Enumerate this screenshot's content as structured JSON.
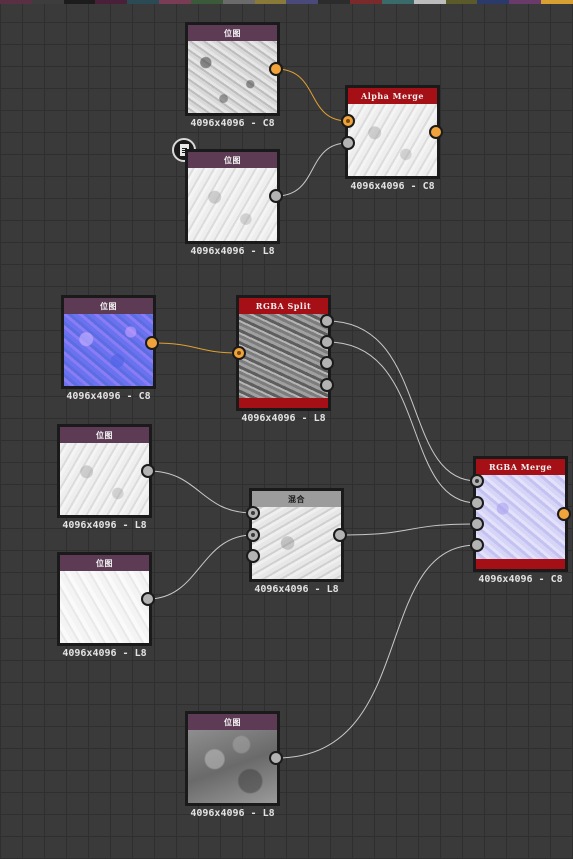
{
  "palette_swatches": [
    "#5a2f44",
    "#3d3d3d",
    "#1c1c1c",
    "#4a1f3a",
    "#2a4a55",
    "#7a3b55",
    "#3a5a3a",
    "#6b6b6b",
    "#8a7a3a",
    "#4a4a7a",
    "#2c2c2c",
    "#7a2a2a",
    "#3a6a6a",
    "#bdbdbd",
    "#5a5a2a",
    "#2a3a6a",
    "#6a3a6a",
    "#d8a030"
  ],
  "colors": {
    "header_purple": "#5e3b55",
    "header_red": "#a50f16",
    "header_gray": "#9c9c9c",
    "port_orange": "#f0a33a",
    "port_gray": "#b3b3b3",
    "wire_orange": "#e0a030",
    "wire_gray": "#c8c8c8"
  },
  "nodes": {
    "bitmap1": {
      "title": "位图",
      "caption": "4096x4096 - C8"
    },
    "bitmap2": {
      "title": "位图",
      "caption": "4096x4096 - L8"
    },
    "alpha_merge": {
      "title": "Alpha Merge",
      "caption": "4096x4096 - C8"
    },
    "bitmap_normal": {
      "title": "位图",
      "caption": "4096x4096 - C8"
    },
    "rgba_split": {
      "title": "RGBA Split",
      "caption": "4096x4096 - L8"
    },
    "bitmap3": {
      "title": "位图",
      "caption": "4096x4096 - L8"
    },
    "bitmap4": {
      "title": "位图",
      "caption": "4096x4096 - L8"
    },
    "blend": {
      "title": "混合",
      "caption": "4096x4096 - L8"
    },
    "rgba_merge": {
      "title": "RGBA Merge",
      "caption": "4096x4096 - C8"
    },
    "bitmap5": {
      "title": "位图",
      "caption": "4096x4096 - L8"
    }
  },
  "icons": {
    "comment_badge": "document-icon"
  }
}
